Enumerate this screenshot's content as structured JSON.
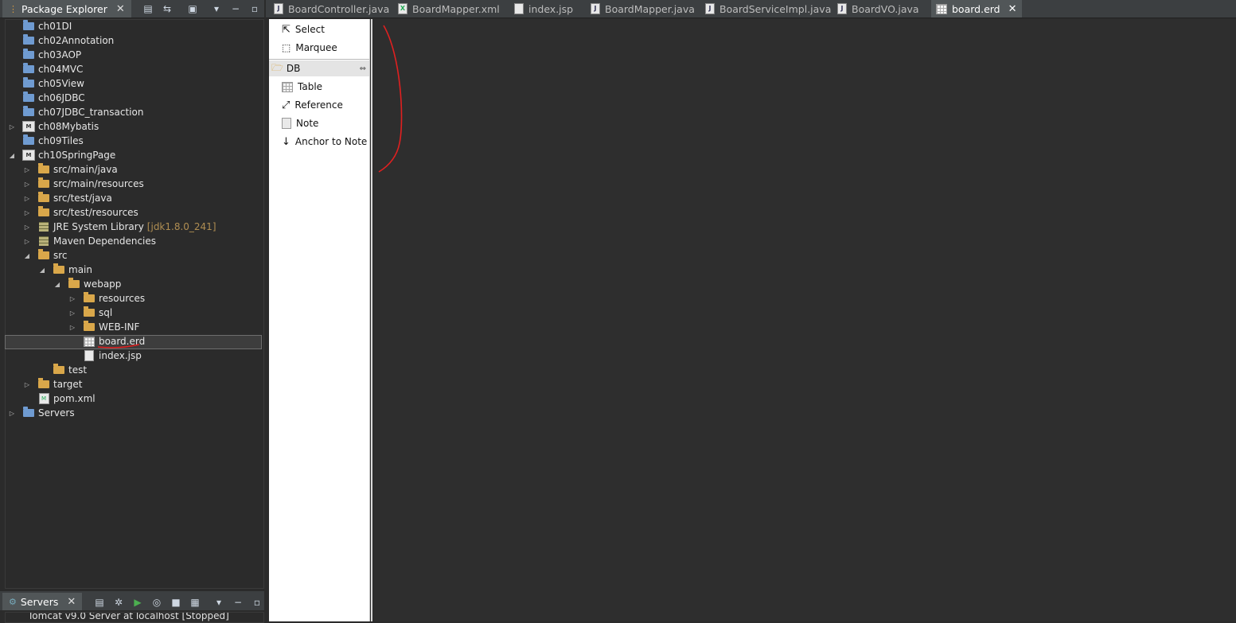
{
  "package_explorer": {
    "title": "Package Explorer",
    "close": "✕",
    "tree": [
      {
        "label": "ch01DI"
      },
      {
        "label": "ch02Annotation"
      },
      {
        "label": "ch03AOP"
      },
      {
        "label": "ch04MVC"
      },
      {
        "label": "ch05View"
      },
      {
        "label": "ch06JDBC"
      },
      {
        "label": "ch07JDBC_transaction"
      },
      {
        "label": "ch08Mybatis"
      },
      {
        "label": "ch09Tiles"
      },
      {
        "label": "ch10SpringPage"
      },
      {
        "label": "src/main/java"
      },
      {
        "label": "src/main/resources"
      },
      {
        "label": "src/test/java"
      },
      {
        "label": "src/test/resources"
      },
      {
        "label": "JRE System Library",
        "suffix": "[jdk1.8.0_241]"
      },
      {
        "label": "Maven Dependencies"
      },
      {
        "label": "src"
      },
      {
        "label": "main"
      },
      {
        "label": "webapp"
      },
      {
        "label": "resources"
      },
      {
        "label": "sql"
      },
      {
        "label": "WEB-INF"
      },
      {
        "label": "board.erd"
      },
      {
        "label": "index.jsp"
      },
      {
        "label": "test"
      },
      {
        "label": "target"
      },
      {
        "label": "pom.xml"
      },
      {
        "label": "Servers"
      }
    ]
  },
  "servers_view": {
    "title": "Servers",
    "close": "✕",
    "first_entry": "Tomcat v9.0 Server at localhost  [Stopped]"
  },
  "editor_tabs": [
    {
      "label": "BoardController.java"
    },
    {
      "label": "BoardMapper.xml"
    },
    {
      "label": "index.jsp"
    },
    {
      "label": "BoardMapper.java"
    },
    {
      "label": "BoardServiceImpl.java"
    },
    {
      "label": "BoardVO.java"
    },
    {
      "label": "board.erd",
      "close": "✕"
    }
  ],
  "palette": {
    "tools": [
      {
        "label": "Select"
      },
      {
        "label": "Marquee"
      }
    ],
    "drawer": "DB",
    "db_items": [
      {
        "label": "Table"
      },
      {
        "label": "Reference"
      },
      {
        "label": "Note"
      },
      {
        "label": "Anchor to Note"
      }
    ]
  },
  "colors": {
    "annotation_red": "#e02020",
    "canvas_bg": "#2e2e2e",
    "palette_bg": "#ffffff"
  }
}
